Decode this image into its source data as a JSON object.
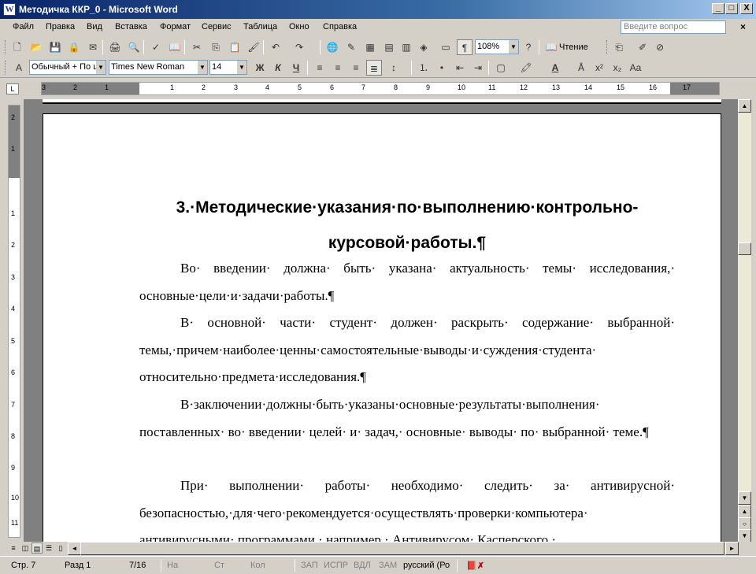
{
  "window": {
    "title": "Методичка ККР_0 - Microsoft Word",
    "app_icon": "W",
    "minimize": "_",
    "maximize": "□",
    "close": "X"
  },
  "menu": {
    "items": [
      "Файл",
      "Правка",
      "Вид",
      "Вставка",
      "Формат",
      "Сервис",
      "Таблица",
      "Окно",
      "Справка"
    ],
    "help_placeholder": "Введите вопрос",
    "doc_close": "×"
  },
  "toolbar": {
    "zoom": "108%",
    "reading_label": "Чтение",
    "style": "Обычный + По ц",
    "font": "Times New Roman",
    "size": "14",
    "bold": "Ж",
    "italic": "К",
    "underline": "Ч",
    "font_color_letter": "А",
    "superscript": "x²",
    "subscript": "x₂"
  },
  "ruler": {
    "horizontal": [
      "3",
      "2",
      "1",
      "1",
      "2",
      "3",
      "4",
      "5",
      "6",
      "7",
      "8",
      "9",
      "10",
      "11",
      "12",
      "13",
      "14",
      "15",
      "16",
      "17"
    ],
    "vertical": [
      "2",
      "1",
      "1",
      "2",
      "3",
      "4",
      "5",
      "6",
      "7",
      "8",
      "9",
      "10",
      "11"
    ]
  },
  "document": {
    "heading": "3.·Методические·указания·по·выполнению·контрольно-курсовой·работы.¶",
    "paragraphs": [
      "Во· введении· должна· быть· указана· актуальность· темы· исследования,· основные·цели·и·задачи·работы.¶",
      "В· основной· части· студент· должен· раскрыть· содержание· выбранной· темы,·причем·наиболее·ценны·самостоятельные·выводы·и·суждения·студента· относительно·предмета·исследования.¶",
      "В·заключении·должны·быть·указаны·основные·результаты·выполнения· поставленных· во· введении· целей· и· задач,· основные· выводы· по· выбранной· теме.¶",
      "При· выполнении· работы· необходимо· следить· за· антивирусной· безопасностью,·для·чего·рекомендуется·осуществлять·проверки·компьютера· антивирусными· программами,· например,· Антивирусом· Касперского,·"
    ]
  },
  "status": {
    "page": "Стр. 7",
    "section": "Разд 1",
    "pages": "7/16",
    "at": "На",
    "line": "Ст",
    "col": "Кол",
    "rec": "ЗАП",
    "trk": "ИСПР",
    "ext": "ВДЛ",
    "ovr": "ЗАМ",
    "language": "русский (Ро"
  }
}
